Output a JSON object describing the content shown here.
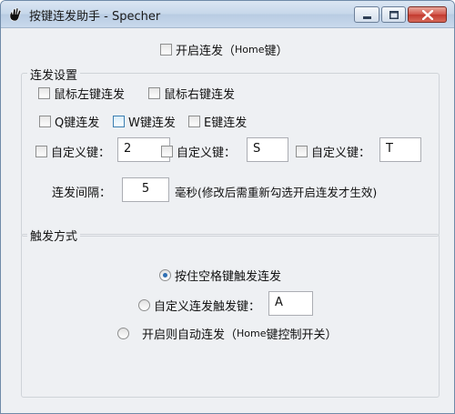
{
  "window": {
    "title": "按键连发助手 - Specher"
  },
  "top": {
    "enable_label": "开启连发（",
    "enable_key": "Home",
    "enable_suffix": "键）"
  },
  "repeat_group": {
    "legend": "连发设置",
    "mouse_left": "鼠标左键连发",
    "mouse_right": "鼠标右键连发",
    "q_key": "Q键连发",
    "w_key": "W键连发",
    "e_key": "E键连发",
    "custom_label": "自定义键：",
    "custom_values": [
      "2",
      "S",
      "T"
    ],
    "interval_label": "连发间隔：",
    "interval_value": "5",
    "interval_note": "毫秒(修改后需重新勾选开启连发才生效)"
  },
  "trigger_group": {
    "legend": "触发方式",
    "hold_space": "按住空格键触发连发",
    "custom_trigger": "自定义连发触发键：",
    "custom_trigger_value": "A",
    "auto_prefix": "开启则自动连发（",
    "auto_key": "Home",
    "auto_suffix": "键控制开关）"
  }
}
